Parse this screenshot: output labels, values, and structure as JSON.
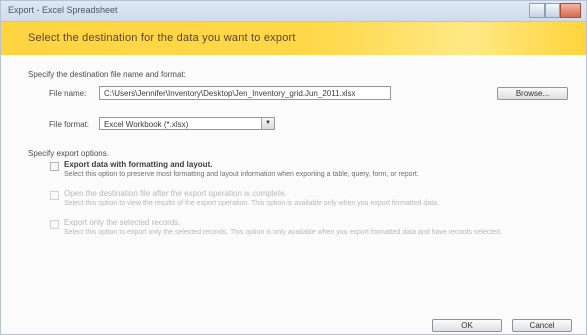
{
  "window": {
    "title": "Export - Excel Spreadsheet",
    "banner_title": "Select the destination for the data you want to export"
  },
  "destination": {
    "section_label": "Specify the destination file name and format:",
    "file_name_label": "File name:",
    "file_name_value": "C:\\Users\\Jennifer\\Inventory\\Desktop\\Jen_Inventory_grid.Jun_2011.xlsx",
    "browse_label": "Browse...",
    "file_format_label": "File format:",
    "file_format_value": "Excel Workbook (*.xlsx)"
  },
  "export_options": {
    "section_label": "Specify export options.",
    "option1_title": "Export data with formatting and layout.",
    "option1_desc": "Select this option to preserve most formatting and layout information when exporting a table, query, form, or report.",
    "option2_title": "Open the destination file after the export operation is complete.",
    "option2_desc": "Select this option to view the results of the export operation. This option is available only when you export formatted data.",
    "option3_title": "Export only the selected records.",
    "option3_desc": "Select this option to export only the selected records. This option is only available when you export formatted data and have records selected."
  },
  "buttons": {
    "ok_label": "OK",
    "cancel_label": "Cancel"
  }
}
